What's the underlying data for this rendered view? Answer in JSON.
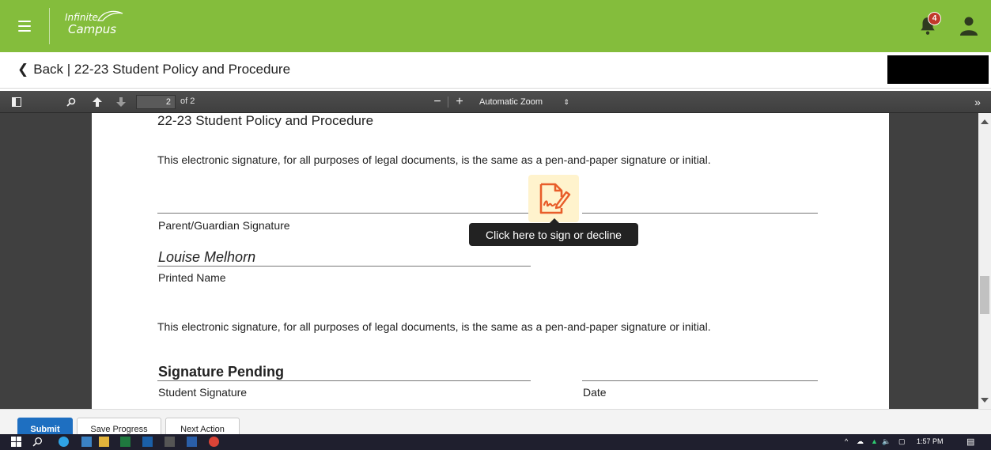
{
  "header": {
    "logo_line1": "Infinite",
    "logo_line2": "Campus",
    "notification_count": "4"
  },
  "subheader": {
    "back_label": "Back | 22-23 Student Policy and Procedure"
  },
  "pdf_toolbar": {
    "page_number": "2",
    "page_of": "of 2",
    "zoom_label": "Automatic Zoom"
  },
  "document": {
    "title": "22-23 Student Policy  and Procedure",
    "disclaimer_1": "This electronic signature, for all purposes of legal documents, is the same as a pen-and-paper signature or initial.",
    "parent_signature_label": "Parent/Guardian Signature",
    "printed_name_value": "Louise Melhorn",
    "printed_name_label": "Printed Name",
    "disclaimer_2": "This electronic signature, for all purposes of legal documents, is the same as a pen-and-paper signature or initial.",
    "student_signature_status": "Signature Pending",
    "student_signature_label": "Student Signature",
    "date_label": "Date",
    "sign_tooltip": "Click here to sign or decline"
  },
  "actions": {
    "submit": "Submit",
    "save_progress": "Save Progress",
    "next_action": "Next Action"
  },
  "taskbar": {
    "clock": "1:57 PM"
  },
  "colors": {
    "brand_green": "#84bd3c",
    "primary_blue": "#1e6fc1",
    "sign_orange": "#e85d2a",
    "badge_red": "#c0392b"
  }
}
